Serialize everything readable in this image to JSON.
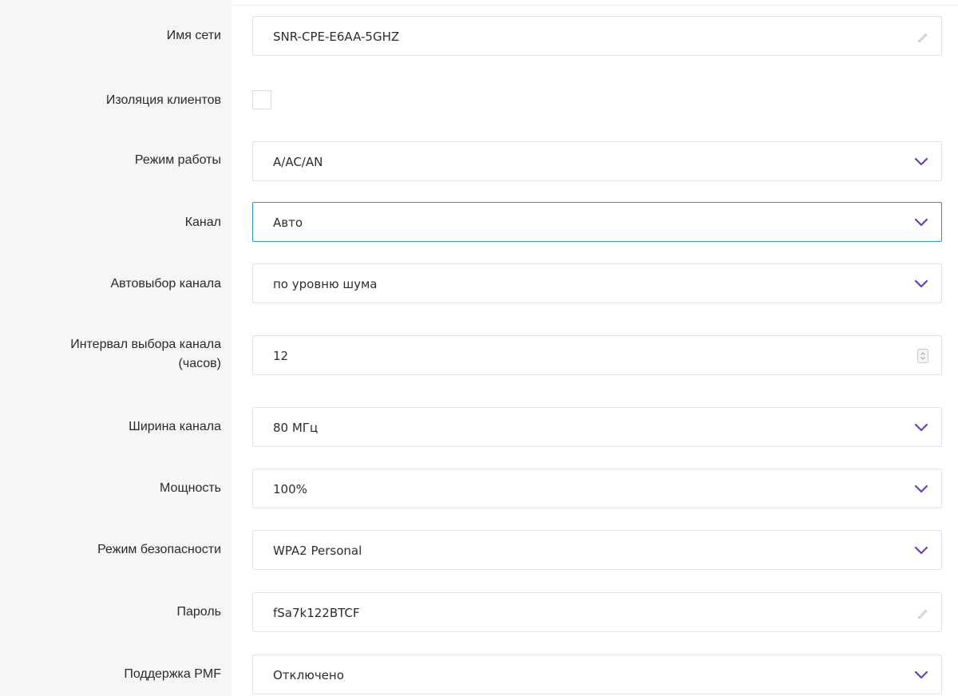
{
  "form": {
    "network_name": {
      "label": "Имя сети",
      "value": "SNR-CPE-E6AA-5GHZ",
      "icon": "pencil-icon"
    },
    "client_isolation": {
      "label": "Изоляция клиентов",
      "checked": false
    },
    "mode": {
      "label": "Режим работы",
      "value": "A/AC/AN",
      "icon": "chevron-down-icon"
    },
    "channel": {
      "label": "Канал",
      "value": "Авто",
      "icon": "chevron-down-icon",
      "focused": true
    },
    "channel_auto_select": {
      "label": "Автовыбор канала",
      "value": "по уровню шума",
      "icon": "chevron-down-icon"
    },
    "channel_interval": {
      "label_line1": "Интервал выбора канала",
      "label_line2": "(часов)",
      "value": "12",
      "icon": "stepper-icon"
    },
    "channel_width": {
      "label": "Ширина канала",
      "value": "80 МГц",
      "icon": "chevron-down-icon"
    },
    "power": {
      "label": "Мощность",
      "value": "100%",
      "icon": "chevron-down-icon"
    },
    "security_mode": {
      "label": "Режим безопасности",
      "value": "WPA2 Personal",
      "icon": "chevron-down-icon"
    },
    "password": {
      "label": "Пароль",
      "value": "fSa7k122BTCF",
      "icon": "pencil-icon"
    },
    "pmf_support": {
      "label": "Поддержка PMF",
      "value": "Отключено",
      "icon": "chevron-down-icon"
    }
  },
  "colors": {
    "accent_chevron": "#6c3fb5",
    "focus_border": "#2f95c8",
    "label_column_bg": "#f6f6f6",
    "field_border": "#e3e3e3"
  }
}
